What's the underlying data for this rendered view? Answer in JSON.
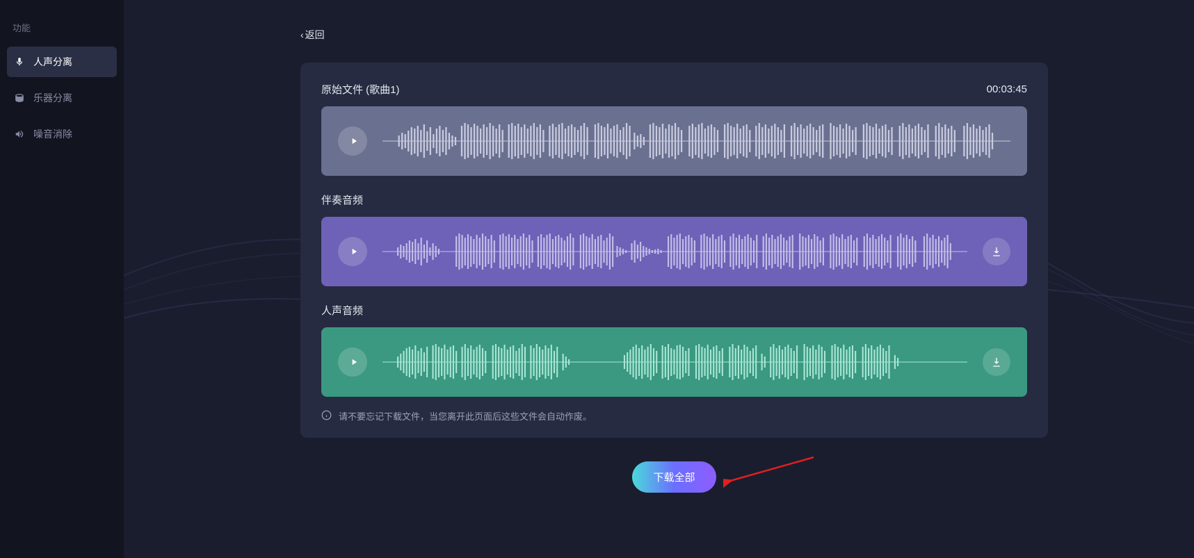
{
  "sidebar": {
    "title": "功能",
    "items": [
      {
        "label": "人声分离",
        "icon": "mic"
      },
      {
        "label": "乐器分离",
        "icon": "drum"
      },
      {
        "label": "噪音消除",
        "icon": "noise"
      }
    ]
  },
  "back_label": "返回",
  "tracks": {
    "original": {
      "title": "原始文件 (歌曲1)",
      "duration": "00:03:45",
      "color": "gray"
    },
    "accompaniment": {
      "title": "伴奏音频",
      "color": "purple"
    },
    "vocal": {
      "title": "人声音频",
      "color": "green"
    }
  },
  "notice": "请不要忘记下载文件，当您离开此页面后这些文件会自动作废。",
  "download_all": "下载全部"
}
